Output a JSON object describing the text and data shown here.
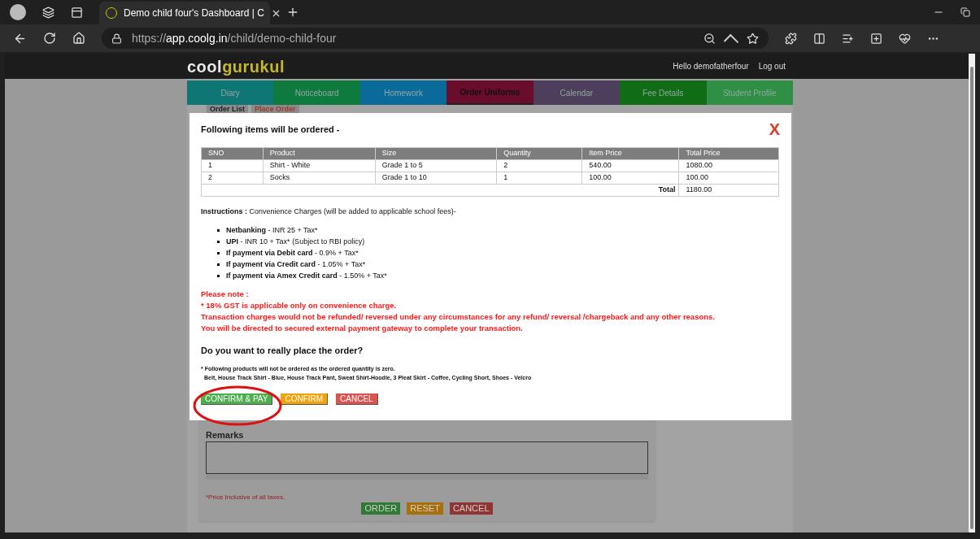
{
  "browser": {
    "tab_title": "Demo child four's Dashboard | C",
    "url_prefix": "https://",
    "url_host": "app.coolg.in",
    "url_path": "/child/demo-child-four"
  },
  "header": {
    "logo_first": "cool",
    "logo_second": "gurukul",
    "greeting": "Hello demofatherfour",
    "logout": "Log out"
  },
  "nav_tabs": [
    {
      "label": "Diary",
      "selected": false,
      "color": "#0f7676"
    },
    {
      "label": "Noticeboard",
      "selected": false,
      "color": "#0f7a3e"
    },
    {
      "label": "Homework",
      "selected": false,
      "color": "#0a6b9b"
    },
    {
      "label": "Order Uniforms",
      "selected": true,
      "color": "#6a0c2b"
    },
    {
      "label": "Calendar",
      "selected": false,
      "color": "#4d3f5b"
    },
    {
      "label": "Fee Details",
      "selected": false,
      "color": "#116c16"
    },
    {
      "label": "Student Profile",
      "selected": false,
      "color": "#2f8f45"
    }
  ],
  "sub_tabs": [
    {
      "label": "Order List",
      "selected": false
    },
    {
      "label": "Place Order",
      "selected": true
    }
  ],
  "modal": {
    "title": "Following items will be ordered -",
    "close": "X",
    "table": {
      "columns": [
        "SNO",
        "Product",
        "Size",
        "Quantity",
        "Item Price",
        "Total Price"
      ],
      "rows": [
        [
          "1",
          "Shirt - White",
          "Grade 1 to 5",
          "2",
          "540.00",
          "1080.00"
        ],
        [
          "2",
          "Socks",
          "Grade 1 to 10",
          "1",
          "100.00",
          "100.00"
        ]
      ],
      "total_label": "Total",
      "total_value": "1180.00"
    },
    "instructions": "**Instructions :** Convenience Charges (will be added to applicable school fees)-",
    "charges": [
      "**Netbanking** - INR 25 + Tax*",
      "**UPI** - INR 10 + Tax* (Subject to RBI policy)",
      "**If payment via Debit card** - 0.9% + Tax*",
      "**If payment via Credit card** - 1.05% + Tax*",
      "**If payment via Amex Credit card** - 1.50% + Tax*"
    ],
    "notes": [
      "Please note :",
      "* 18% GST is applicable only on convenience charge.",
      "Transaction charges would not be refunded/ reversed under any circumstances for any refund/ reversal /chargeback and any other reasons.",
      "You will be directed to secured external payment gateway to complete your transaction."
    ],
    "question": "Do you want to really place the order?",
    "footnote": "* Following products will not be ordered as the ordered quantity is zero.",
    "zero_products": "Belt, House Track Shirt - Blue, House Track Pant, Sweat Shirt-Hoodie, 3 Pleat Skirt - Coffee, Cycling Short, Shoes - Velcro",
    "buttons": [
      {
        "label": "CONFIRM & PAY",
        "color": "#4cae4c"
      },
      {
        "label": "CONFIRM",
        "color": "#f0a30a"
      },
      {
        "label": "CANCEL",
        "color": "#d9534f"
      }
    ]
  },
  "form": {
    "remarks_label": "Remarks",
    "price_note": "*Price Inclusive of all taxes.",
    "buttons": [
      {
        "label": "ORDER",
        "color": "#2f7a35"
      },
      {
        "label": "RESET",
        "color": "#a8700a"
      },
      {
        "label": "CANCEL",
        "color": "#8f3634"
      }
    ]
  }
}
